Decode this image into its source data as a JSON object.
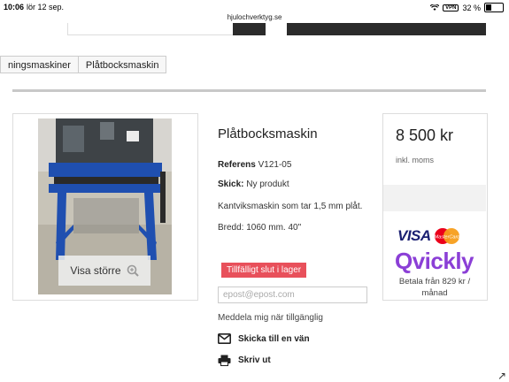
{
  "status": {
    "time": "10:06",
    "date": "lör 12 sep.",
    "url": "hjulochverktyg.se",
    "vpn": "VPN",
    "battery": "32 %"
  },
  "breadcrumb": [
    "ningsmaskiner",
    "Plåtbocksmaskin"
  ],
  "gallery": {
    "zoom_label": "Visa större"
  },
  "product": {
    "title": "Plåtbocksmaskin",
    "reference_label": "Referens",
    "reference_value": "V121-05",
    "condition_label": "Skick:",
    "condition_value": "Ny produkt",
    "description": "Kantviksmaskin som tar 1,5 mm plåt.",
    "width": "Bredd: 1060 mm. 40\"",
    "availability": "Tillfälligt slut i lager",
    "email_placeholder": "epost@epost.com",
    "notify_text": "Meddela mig när tillgänglig",
    "send_to_friend": "Skicka till en vän",
    "print": "Skriv ut"
  },
  "pricing": {
    "price": "8 500 kr",
    "vat_note": "inkl. moms",
    "visa": "VISA",
    "mastercard": "MasterCard",
    "qvickly": "Qvickly",
    "installment": "Betala från 829 kr / månad"
  },
  "colors": {
    "sold_out": "#e8505b",
    "qvickly": "#8b3fd6",
    "visa": "#1a1f71",
    "machine_blue": "#1f4fb0"
  }
}
